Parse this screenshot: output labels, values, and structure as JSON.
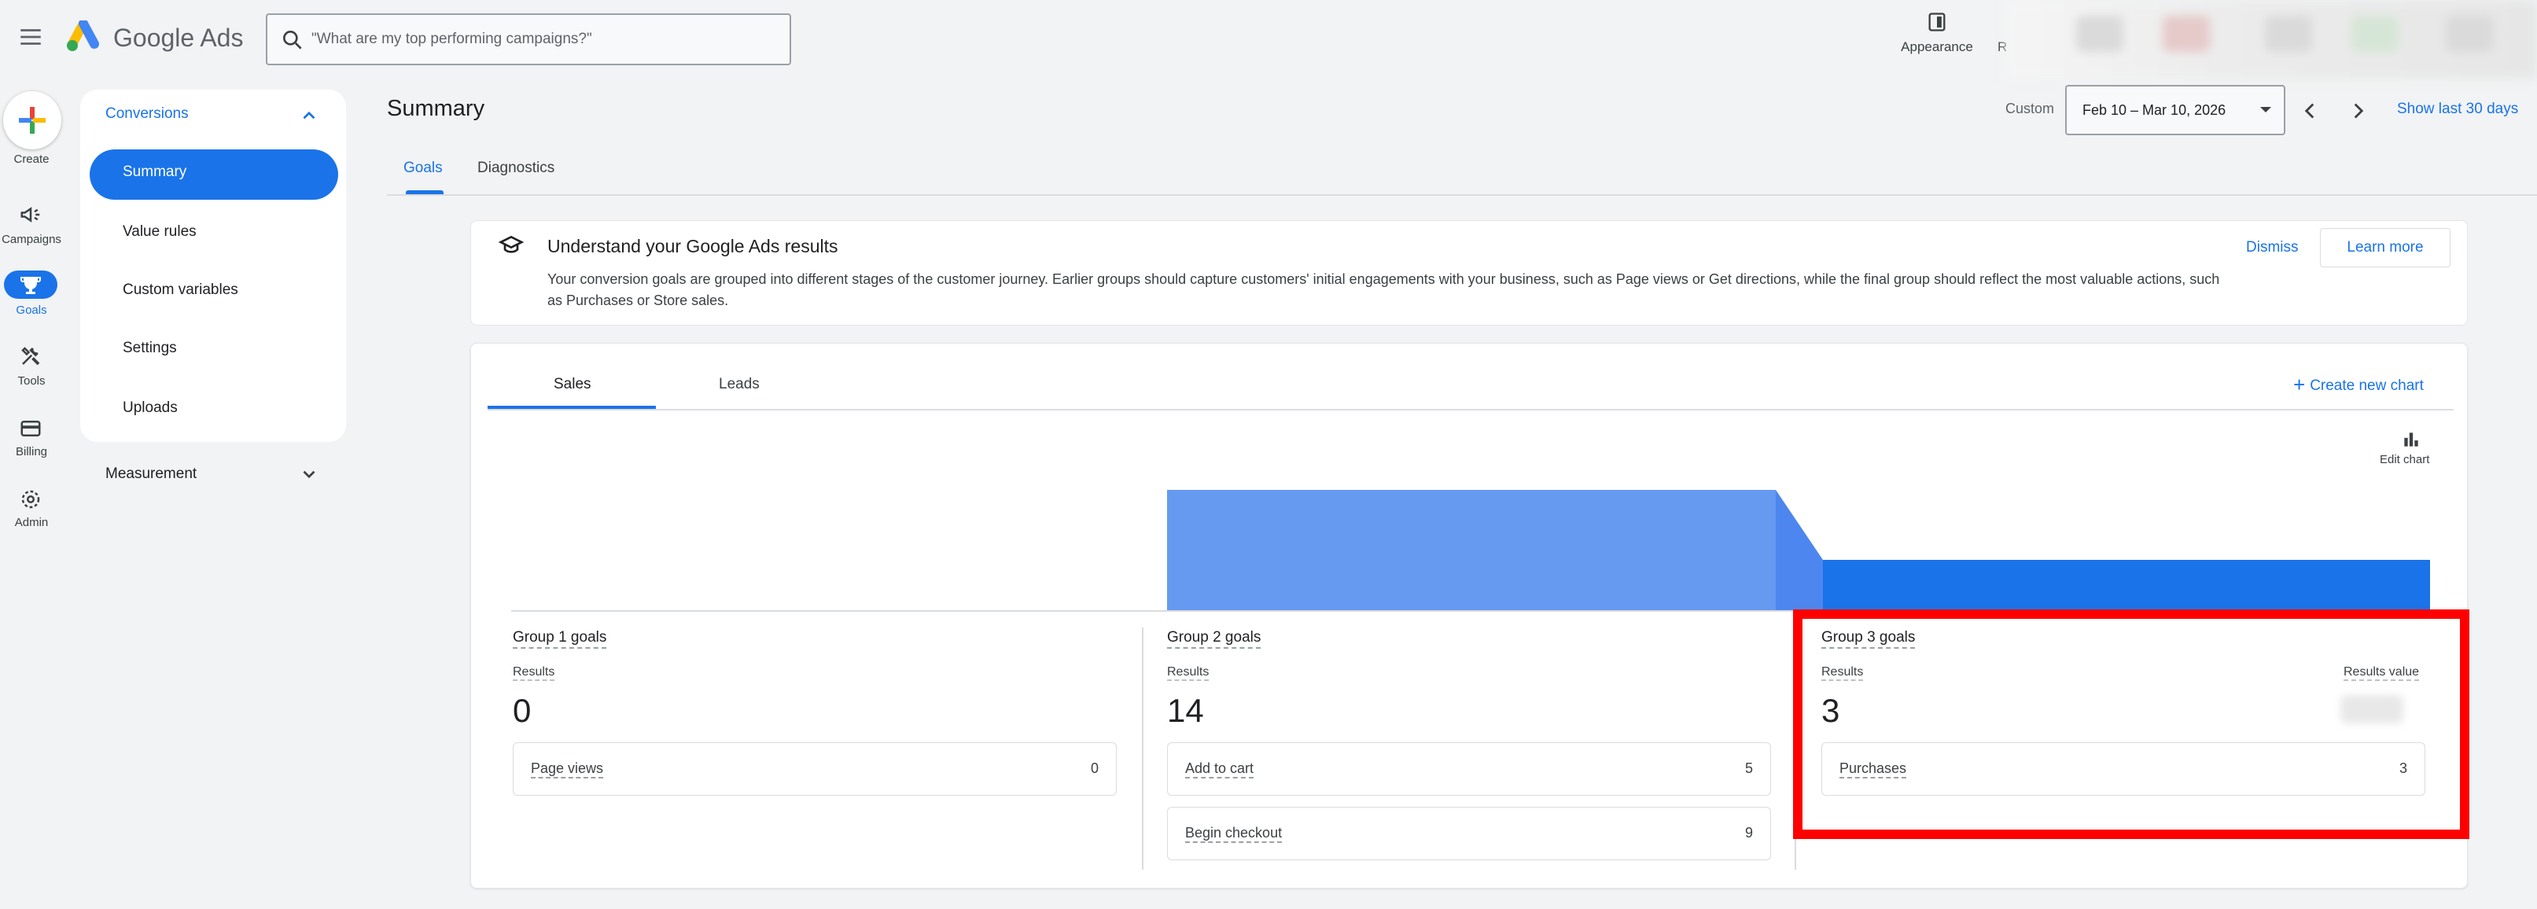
{
  "app": {
    "brand": "Google Ads"
  },
  "search": {
    "placeholder": "\"What are my top performing campaigns?\""
  },
  "topbar": {
    "appearance_label": "Appearance",
    "cut_label": "R"
  },
  "rail": {
    "create_label": "Create",
    "items": [
      {
        "label": "Campaigns",
        "icon": "megaphone-icon"
      },
      {
        "label": "Goals",
        "icon": "trophy-icon",
        "active": true
      },
      {
        "label": "Tools",
        "icon": "tools-icon"
      },
      {
        "label": "Billing",
        "icon": "credit-card-icon"
      },
      {
        "label": "Admin",
        "icon": "gear-icon"
      }
    ]
  },
  "sidenav": {
    "section": "Conversions",
    "items": [
      "Summary",
      "Value rules",
      "Custom variables",
      "Settings",
      "Uploads"
    ],
    "active_index": 0,
    "measurement": "Measurement"
  },
  "header": {
    "title": "Summary",
    "custom_label": "Custom",
    "date_range": "Feb 10 – Mar 10, 2026",
    "show_last": "Show last 30 days"
  },
  "tabs": [
    "Goals",
    "Diagnostics"
  ],
  "banner": {
    "title": "Understand your Google Ads results",
    "body": "Your conversion goals are grouped into different stages of the customer journey. Earlier groups should capture customers' initial engagements with your business, such as Page views or Get directions, while the final group should reflect the most valuable actions, such as Purchases or Store sales.",
    "dismiss": "Dismiss",
    "learn_more": "Learn more"
  },
  "card": {
    "tabs": [
      "Sales",
      "Leads"
    ],
    "create_chart": "Create new chart",
    "edit_chart": "Edit chart"
  },
  "groups": [
    {
      "title": "Group 1 goals",
      "results_label": "Results",
      "results": "0",
      "goals": [
        {
          "name": "Page views",
          "value": "0"
        }
      ]
    },
    {
      "title": "Group 2 goals",
      "results_label": "Results",
      "results": "14",
      "goals": [
        {
          "name": "Add to cart",
          "value": "5"
        },
        {
          "name": "Begin checkout",
          "value": "9"
        }
      ]
    },
    {
      "title": "Group 3 goals",
      "results_label": "Results",
      "results": "3",
      "value_label": "Results value",
      "goals": [
        {
          "name": "Purchases",
          "value": "3"
        }
      ]
    }
  ],
  "colors": {
    "accent": "#1a73e8",
    "funnel_light": "#6699f0",
    "funnel_dark": "#1a73e8",
    "highlight": "#ff0000"
  }
}
